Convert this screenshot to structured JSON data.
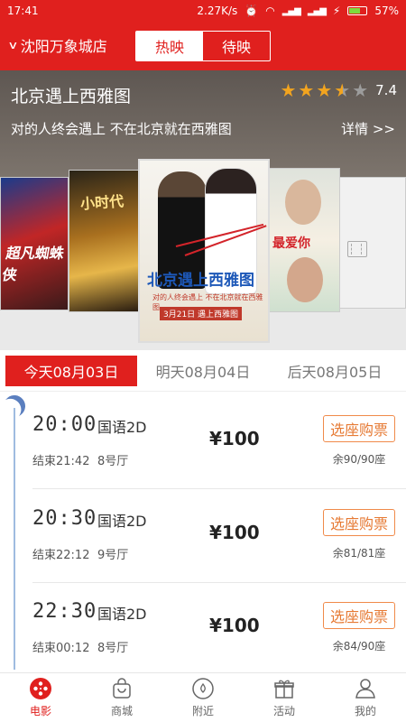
{
  "status_bar": {
    "time": "17:41",
    "speed": "2.27K/s",
    "battery": "57%",
    "battery_level": 0.57
  },
  "header": {
    "cinema": "沈阳万象城店",
    "tabs": [
      {
        "label": "热映",
        "active": true
      },
      {
        "label": "待映",
        "active": false
      }
    ]
  },
  "movie": {
    "title": "北京遇上西雅图",
    "stars": 3.5,
    "score": "7.4",
    "tagline": "对的人终会遇上 不在北京就在西雅图",
    "detail_link": "详情 >>",
    "posters": [
      {
        "name": "spider-man",
        "text": "超凡蜘蛛侠"
      },
      {
        "name": "poster-2",
        "text": "小时代"
      },
      {
        "name": "finding-mr-right",
        "title": "北京遇上西雅图",
        "tag": "对的人终会遇上 不在北京就在西雅图",
        "date": "3月21日 遇上西雅图"
      },
      {
        "name": "poster-4",
        "text": "最爱你"
      },
      {
        "name": "poster-5-placeholder"
      }
    ]
  },
  "dates": [
    {
      "label": "今天08月03日",
      "active": true
    },
    {
      "label": "明天08月04日",
      "active": false
    },
    {
      "label": "后天08月05日",
      "active": false
    }
  ],
  "showtimes": [
    {
      "start": "20:00",
      "lang": "国语2D",
      "end": "结束21:42",
      "hall": "8号厅",
      "price": "¥100",
      "buy": "选座购票",
      "seats": "余90/90座"
    },
    {
      "start": "20:30",
      "lang": "国语2D",
      "end": "结束22:12",
      "hall": "9号厅",
      "price": "¥100",
      "buy": "选座购票",
      "seats": "余81/81座"
    },
    {
      "start": "22:30",
      "lang": "国语2D",
      "end": "结束00:12",
      "hall": "8号厅",
      "price": "¥100",
      "buy": "选座购票",
      "seats": "余84/90座"
    }
  ],
  "nav": [
    {
      "label": "电影",
      "icon": "film-reel-icon",
      "active": true
    },
    {
      "label": "商城",
      "icon": "shopping-bag-icon",
      "active": false
    },
    {
      "label": "附近",
      "icon": "location-icon",
      "active": false
    },
    {
      "label": "活动",
      "icon": "gift-icon",
      "active": false
    },
    {
      "label": "我的",
      "icon": "person-icon",
      "active": false
    }
  ],
  "colors": {
    "brand": "#e0201e",
    "star": "#f2a41f",
    "buy": "#e67a34",
    "timeline": "#9fbce0"
  }
}
